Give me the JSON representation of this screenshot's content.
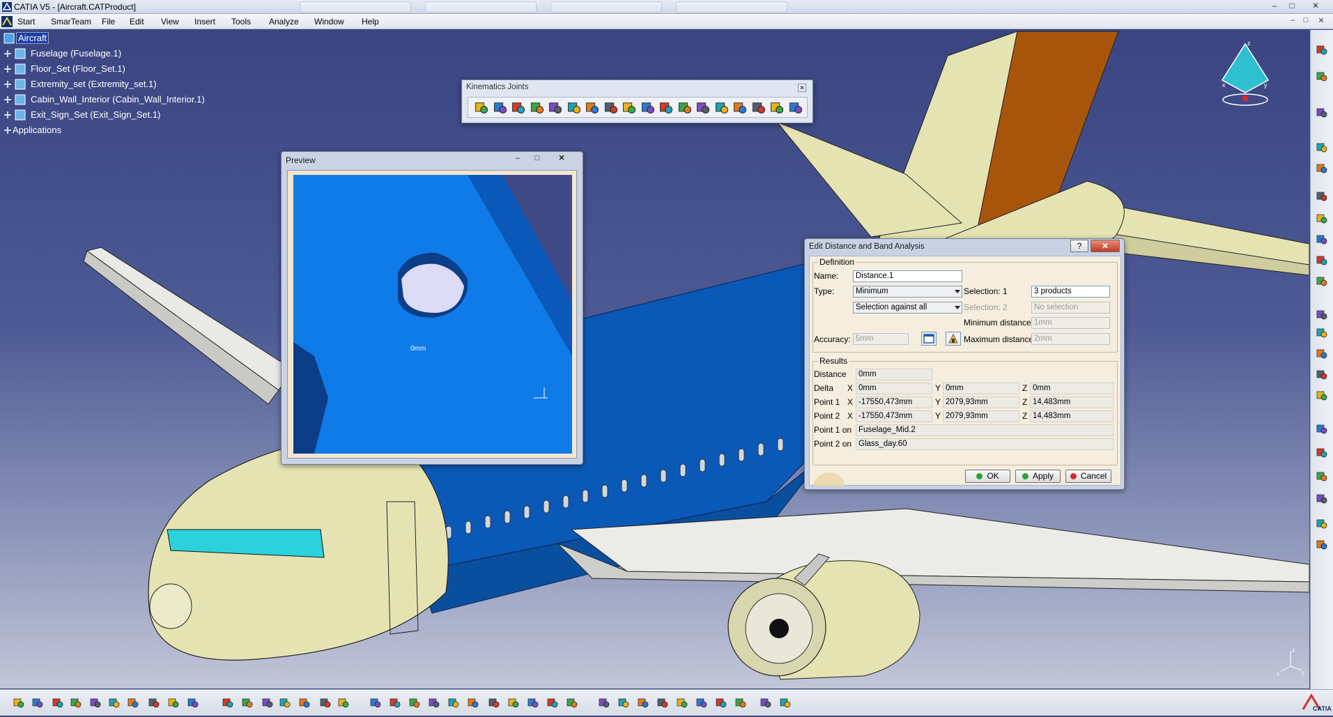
{
  "window": {
    "title": "CATIA V5 - [Aircraft.CATProduct]",
    "controls": [
      "–",
      "□",
      "✕"
    ],
    "mdi_controls": [
      "–",
      "□",
      "✕"
    ]
  },
  "menu": {
    "items": [
      {
        "name": "start",
        "label": "Start"
      },
      {
        "name": "smarteam",
        "label": "SmarTeam"
      },
      {
        "name": "file",
        "label": "File"
      },
      {
        "name": "edit",
        "label": "Edit"
      },
      {
        "name": "view",
        "label": "View"
      },
      {
        "name": "insert",
        "label": "Insert"
      },
      {
        "name": "tools",
        "label": "Tools"
      },
      {
        "name": "analyze",
        "label": "Analyze"
      },
      {
        "name": "window",
        "label": "Window"
      },
      {
        "name": "help",
        "label": "Help"
      }
    ]
  },
  "tree": {
    "items": [
      {
        "label": "Aircraft",
        "selected": true
      },
      {
        "label": "Fuselage (Fuselage.1)"
      },
      {
        "label": "Floor_Set (Floor_Set.1)"
      },
      {
        "label": "Extremity_set (Extremity_set.1)"
      },
      {
        "label": "Cabin_Wall_Interior (Cabin_Wall_Interior.1)"
      },
      {
        "label": "Exit_Sign_Set (Exit_Sign_Set.1)"
      },
      {
        "label": "Applications"
      }
    ]
  },
  "kinematics_toolbar": {
    "title": "Kinematics Joints",
    "close": "✕",
    "icon_count": 18
  },
  "preview": {
    "title": "Preview",
    "buttons": [
      "–",
      "□",
      "✕"
    ],
    "annotation": "0mm"
  },
  "distance_dialog": {
    "title": "Edit Distance and Band Analysis",
    "help": "?",
    "close": "✕",
    "definition_label": "Definition",
    "name_label": "Name:",
    "name_value": "Distance.1",
    "type_label": "Type:",
    "type_value": "Minimum",
    "mode_value": "Selection against all",
    "selection1_label": "Selection: 1",
    "selection1_value": "3 products",
    "selection2_label": "Selection: 2",
    "selection2_value": "No selection",
    "min_distance_label": "Minimum distance:",
    "min_distance_value": "1mm",
    "accuracy_label": "Accuracy:",
    "accuracy_value": "5mm",
    "max_distance_label": "Maximum distance:",
    "max_distance_value": "2mm",
    "results_label": "Results",
    "distance_label": "Distance",
    "distance_value": "0mm",
    "delta_label": "Delta",
    "point1_label": "Point 1",
    "point2_label": "Point 2",
    "axis_x": "X",
    "axis_y": "Y",
    "axis_z": "Z",
    "delta": {
      "x": "0mm",
      "y": "0mm",
      "z": "0mm"
    },
    "point1": {
      "x": "-17550,473mm",
      "y": "2079,93mm",
      "z": "14,483mm"
    },
    "point2": {
      "x": "-17550,473mm",
      "y": "2079,93mm",
      "z": "14,483mm"
    },
    "point1_on_label": "Point 1 on",
    "point1_on_value": "Fuselage_Mid.2",
    "point2_on_label": "Point 2 on",
    "point2_on_value": "Glass_day.60",
    "ok_label": "OK",
    "apply_label": "Apply",
    "cancel_label": "Cancel"
  },
  "compass": {
    "z_label": "z",
    "x_label": "x",
    "y_label": "y"
  },
  "axis_triad": {
    "z_label": "z",
    "x_label": "x",
    "y_label": "y"
  },
  "brand": {
    "logo_text": "CATIA"
  },
  "colors": {
    "background_top": "#3a4582",
    "fuselage_blue": "#0b59b6",
    "body_cream": "#e6e3b3",
    "tail_orange": "#a8550c",
    "cockpit_cyan": "#2bd2dc",
    "tree_selection": "#1b3fa8"
  }
}
